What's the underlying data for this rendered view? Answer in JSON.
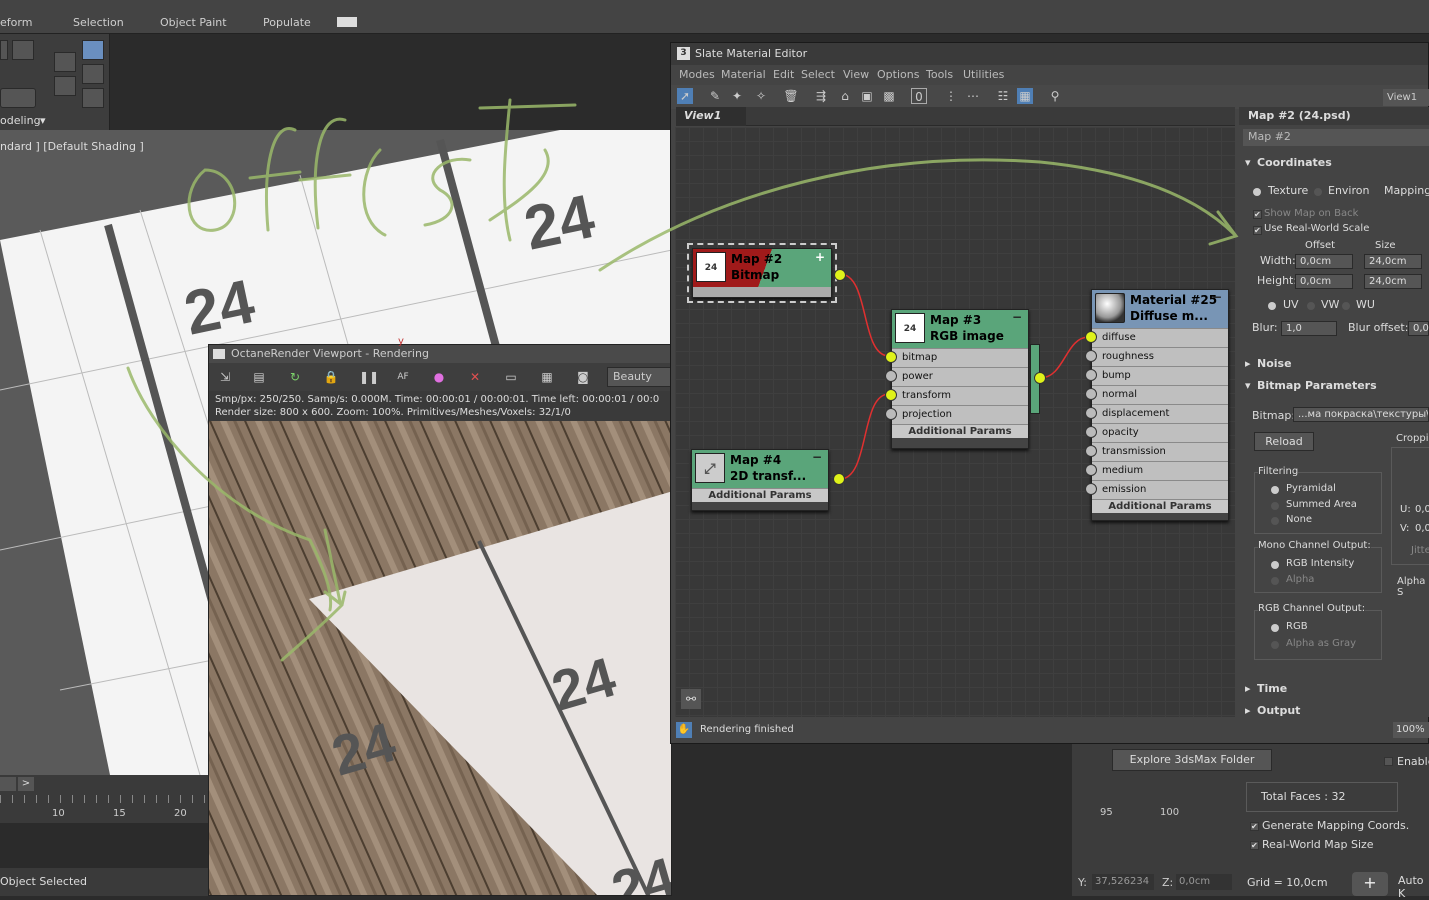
{
  "ribbon": {
    "tabs": [
      "eform",
      "Selection",
      "Object Paint",
      "Populate"
    ]
  },
  "left_panel": {
    "modeling_label": "odeling"
  },
  "viewport": {
    "label": "ndard ] [Default Shading ]",
    "tile_number": "24"
  },
  "octane": {
    "title": "OctaneRender Viewport - Rendering",
    "mode": "Beauty",
    "stats_line1": "Smp/px: 250/250.   Samp/s: 0.000M.   Time: 00:00:01 / 00:00:01.   Time left: 00:00:01 / 00:0",
    "stats_line2": "Render size: 800 x 600.   Zoom: 100%.   Primitives/Meshes/Voxels: 32/1/0",
    "tile_number": "24"
  },
  "slate": {
    "title": "Slate Material Editor",
    "menu": [
      "Modes",
      "Material",
      "Edit",
      "Select",
      "View",
      "Options",
      "Tools",
      "Utilities"
    ],
    "view_button": "View1",
    "view_tab": "View1",
    "status": "Rendering finished",
    "nodes": {
      "map2": {
        "title1": "Map #2",
        "title2": "Bitmap",
        "thumb": "24"
      },
      "map3": {
        "title1": "Map #3",
        "title2": "RGB image",
        "thumb": "24",
        "slots": [
          "bitmap",
          "power",
          "transform",
          "projection"
        ],
        "additional": "Additional Params"
      },
      "map4": {
        "title1": "Map #4",
        "title2": "2D transf...",
        "additional": "Additional Params"
      },
      "mat25": {
        "title1": "Material #25",
        "title2": "Diffuse m...",
        "slots": [
          "diffuse",
          "roughness",
          "bump",
          "normal",
          "displacement",
          "opacity",
          "transmission",
          "medium",
          "emission"
        ],
        "additional": "Additional Params"
      }
    }
  },
  "params": {
    "header": "Map #2 (24.psd)",
    "name_field": "Map #2",
    "coordinates": "Coordinates",
    "texture": "Texture",
    "environ": "Environ",
    "mapping": "Mapping:",
    "show_map_on_back": "Show Map on Back",
    "use_real_world": "Use Real-World Scale",
    "offset": "Offset",
    "size": "Size",
    "width_label": "Width:",
    "width_offset": "0,0cm",
    "width_size": "24,0cm",
    "height_label": "Height:",
    "height_offset": "0,0cm",
    "height_size": "24,0cm",
    "uv": "UV",
    "vw": "VW",
    "wu": "WU",
    "blur_label": "Blur:",
    "blur_value": "1,0",
    "blur_offset_label": "Blur offset:",
    "blur_offset_value": "0,0",
    "noise": "Noise",
    "bitmap_params": "Bitmap Parameters",
    "bitmap_label": "Bitmap:",
    "bitmap_path": "...ма покраска\\текстуры\\",
    "reload": "Reload",
    "cropping": "Croppi",
    "filtering": "Filtering",
    "pyramidal": "Pyramidal",
    "summed_area": "Summed Area",
    "none": "None",
    "mono_output": "Mono Channel Output:",
    "rgb_intensity": "RGB Intensity",
    "alpha": "Alpha",
    "rgb_output": "RGB Channel Output:",
    "rgb": "RGB",
    "alpha_as_gray": "Alpha as Gray",
    "u_label": "U:",
    "u_val": "0,0",
    "v_label": "V:",
    "v_val": "0,0",
    "jitter": "Jitte",
    "alpha_s": "Alpha S",
    "time": "Time",
    "output": "Output",
    "zoom": "100%"
  },
  "bottom": {
    "status": "Object Selected",
    "timeline_ticks": [
      "10",
      "15",
      "20"
    ],
    "right_ticks": [
      "95",
      "100"
    ],
    "explore_button": "Explore 3dsMax Folder",
    "enable": "Enable",
    "total_faces": "Total Faces : 32",
    "gen_mapping": "Generate Mapping Coords.",
    "real_world_map": "Real-World Map Size",
    "y_label": "Y:",
    "y_value": "37,526234",
    "z_label": "Z:",
    "z_value": "0,0cm",
    "grid": "Grid = 10,0cm",
    "auto_key": "Auto K"
  },
  "annotation": {
    "text": "offset",
    "color": "#9ab86a"
  },
  "colors": {
    "socket_active": "#dff21a",
    "node_green": "#5aa57a",
    "node_blue": "#7895b5",
    "wire": "#e03030"
  }
}
